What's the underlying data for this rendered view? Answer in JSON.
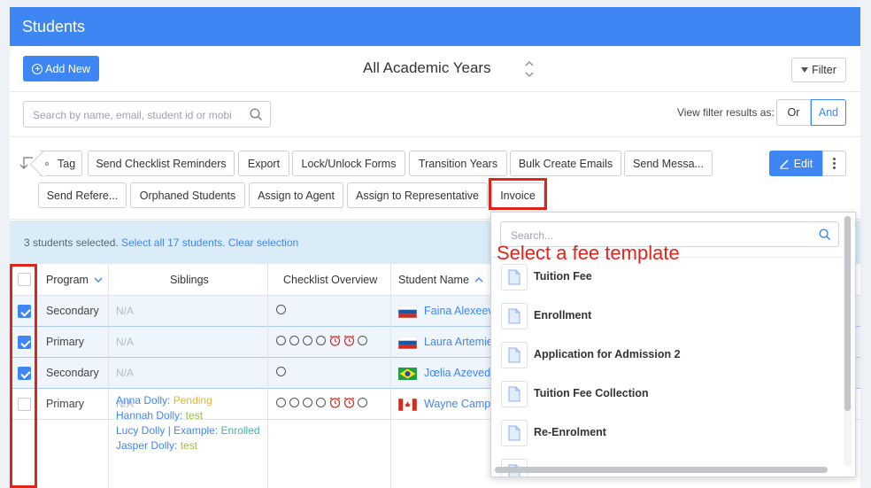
{
  "header": {
    "title": "Students"
  },
  "toolbar": {
    "add_new_label": "Add New",
    "year_label": "All Academic Years",
    "filter_label": "Filter"
  },
  "search": {
    "placeholder": "Search by name, email, student id or mobi"
  },
  "view_filter": {
    "label": "View filter results as:",
    "or_label": "Or",
    "and_label": "And"
  },
  "actions": {
    "tag": "Tag",
    "send_checklist_reminders": "Send Checklist Reminders",
    "export": "Export",
    "lock_unlock_forms": "Lock/Unlock Forms",
    "transition_years": "Transition Years",
    "bulk_create_emails": "Bulk Create Emails",
    "send_messages": "Send Messa...",
    "send_references": "Send Refere...",
    "orphaned_students": "Orphaned Students",
    "assign_to_agent": "Assign to Agent",
    "assign_to_representative": "Assign to Representative",
    "invoice": "Invoice",
    "edit": "Edit"
  },
  "selection": {
    "count_text": "3 students selected.",
    "select_all": "Select all 17 students.",
    "clear": "Clear selection"
  },
  "table": {
    "headers": {
      "program": "Program",
      "siblings": "Siblings",
      "checklist": "Checklist Overview",
      "student_name": "Student Name"
    },
    "rows": [
      {
        "program": "Secondary",
        "siblings": "N/A",
        "student": "Faina Alexeeva",
        "flag": "russia",
        "checked": true
      },
      {
        "program": "Primary",
        "siblings": "N/A",
        "student": "Laura Artemie",
        "flag": "russia",
        "checked": true
      },
      {
        "program": "Secondary",
        "siblings": "N/A",
        "student": "Jœlia Azevedo",
        "flag": "brazil",
        "checked": true
      },
      {
        "program": "Primary",
        "siblings": "N/A",
        "student": "Wayne Campb",
        "flag": "canada",
        "checked": false
      }
    ],
    "sibling_list": [
      {
        "name": "Anna Dolly:",
        "status": "Pending"
      },
      {
        "name": "Hannah Dolly:",
        "status": "test"
      },
      {
        "name": "Lucy Dolly | Example:",
        "status": "Enrolled"
      },
      {
        "name": "Jasper Dolly:",
        "status": "test"
      }
    ]
  },
  "fee_dropdown": {
    "search_placeholder": "Search...",
    "hint": "Select a fee template",
    "items": [
      "Tuition Fee",
      "Enrollment",
      "Application for Admission 2",
      "Tuition Fee Collection",
      "Re-Enrolment"
    ]
  },
  "colors": {
    "primary": "#3f86f5",
    "highlight": "#e1251b",
    "selection_bg": "#d9ecf8"
  }
}
